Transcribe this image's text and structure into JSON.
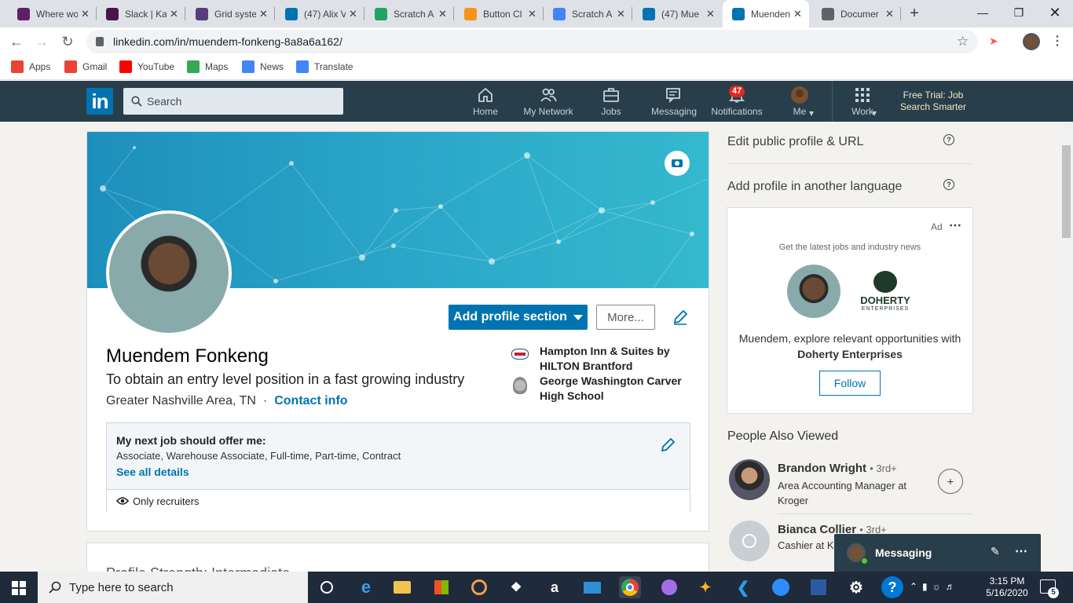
{
  "browser": {
    "tabs": [
      {
        "title": "Where wo",
        "icon": "slack-icon",
        "color": "#611f69"
      },
      {
        "title": "Slack | Ka",
        "icon": "slack-icon",
        "color": "#4a154b"
      },
      {
        "title": "Grid syste",
        "icon": "bootstrap-icon",
        "color": "#563d7c"
      },
      {
        "title": "(47) Alix V",
        "icon": "linkedin-icon",
        "color": "#0073b1"
      },
      {
        "title": "Scratch A",
        "icon": "google-drive-icon",
        "color": "#1fa463"
      },
      {
        "title": "Button Cl",
        "icon": "bitcoin-icon",
        "color": "#f7931a"
      },
      {
        "title": "Scratch A",
        "icon": "google-docs-icon",
        "color": "#4285f4"
      },
      {
        "title": "(47) Mue",
        "icon": "linkedin-icon",
        "color": "#0073b1"
      },
      {
        "title": "Muenden",
        "icon": "linkedin-icon",
        "color": "#0073b1"
      },
      {
        "title": "Documer",
        "icon": "globe-icon",
        "color": "#5f6368"
      }
    ],
    "active_tab": 8,
    "url": "linkedin.com/in/muendem-fonkeng-8a8a6a162/",
    "bookmarks": [
      {
        "label": "Apps",
        "icon": "apps-grid-icon",
        "color": "#ea4335"
      },
      {
        "label": "Gmail",
        "icon": "gmail-icon",
        "color": "#ea4335"
      },
      {
        "label": "YouTube",
        "icon": "youtube-icon",
        "color": "#ff0000"
      },
      {
        "label": "Maps",
        "icon": "maps-icon",
        "color": "#34a853"
      },
      {
        "label": "News",
        "icon": "news-icon",
        "color": "#4285f4"
      },
      {
        "label": "Translate",
        "icon": "translate-icon",
        "color": "#4285f4"
      }
    ]
  },
  "linkedin_nav": {
    "logo": "in",
    "search_placeholder": "Search",
    "items": [
      {
        "label": "Home",
        "icon": "home-icon"
      },
      {
        "label": "My Network",
        "icon": "network-icon"
      },
      {
        "label": "Jobs",
        "icon": "briefcase-icon"
      },
      {
        "label": "Messaging",
        "icon": "messaging-icon"
      },
      {
        "label": "Notifications",
        "icon": "bell-icon",
        "badge": "47"
      },
      {
        "label": "Me",
        "icon": "avatar-icon"
      },
      {
        "label": "Work",
        "icon": "grid-icon"
      }
    ],
    "premium": "Free Trial: Job Search Smarter"
  },
  "profile": {
    "name": "Muendem Fonkeng",
    "headline": "To obtain an entry level position in a fast growing industry",
    "location": "Greater Nashville Area, TN",
    "separator": "·",
    "contact_info": "Contact info",
    "add_section_btn": "Add profile section",
    "more_btn": "More...",
    "experience": [
      {
        "label": "Hampton Inn & Suites by HILTON Brantford",
        "icon": "hampton-logo-icon"
      },
      {
        "label": "George Washington Carver High School",
        "icon": "school-crest-icon"
      }
    ],
    "next_job": {
      "title": "My next job should offer me:",
      "details": "Associate, Warehouse Associate, Full-time, Part-time, Contract",
      "link": "See all details",
      "visibility": "Only recruiters"
    },
    "next_card_partial": "Profile Strength: Intermediate"
  },
  "rail": {
    "edit_public": "Edit public profile & URL",
    "add_language": "Add profile in another language",
    "ad": {
      "label": "Ad",
      "tagline": "Get the latest jobs and industry news",
      "company_logo": "DOHERTY",
      "company_sub": "ENTERPRISES",
      "text_pre": "Muendem, explore relevant opportunities with ",
      "text_company": "Doherty Enterprises",
      "follow": "Follow"
    },
    "people_title": "People Also Viewed",
    "people": [
      {
        "name": "Brandon Wright",
        "degree": "• 3rd+",
        "title": "Area Accounting Manager at Kroger"
      },
      {
        "name": "Bianca Collier",
        "degree": "• 3rd+",
        "title": "Cashier at K"
      }
    ]
  },
  "messaging": {
    "label": "Messaging"
  },
  "taskbar": {
    "search": "Type here to search",
    "time": "3:15 PM",
    "date": "5/16/2020",
    "notif_count": "5"
  }
}
